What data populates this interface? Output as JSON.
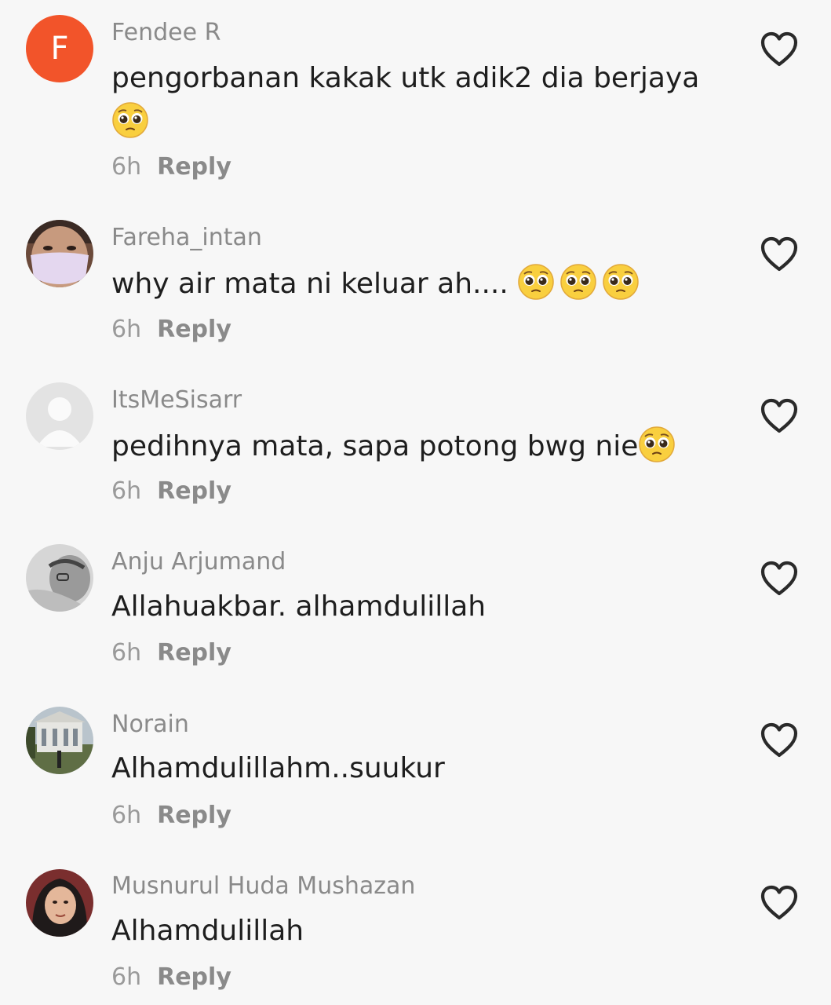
{
  "colors": {
    "background": "#f7f7f7",
    "username": "#8a8a8a",
    "text": "#1e1e1e",
    "meta": "#9a9a9a",
    "avatar_accent": "#f2542a"
  },
  "icons": {
    "like": "heart-outline-icon",
    "emoji": "pleading-face-emoji"
  },
  "comments": [
    {
      "username": "Fendee R",
      "avatar_letter": "F",
      "text": "pengorbanan kakak utk adik2 dia berjaya",
      "time": "6h",
      "reply": "Reply",
      "emoji_count": 1
    },
    {
      "username": "Fareha_intan",
      "text": "why air mata ni keluar ah.... ",
      "time": "6h",
      "reply": "Reply",
      "emoji_count": 3
    },
    {
      "username": "ItsMeSisarr",
      "text": "pedihnya mata, sapa potong bwg nie",
      "time": "6h",
      "reply": "Reply",
      "emoji_count": 1
    },
    {
      "username": "Anju Arjumand",
      "text": "Allahuakbar. alhamdulillah",
      "time": "6h",
      "reply": "Reply",
      "emoji_count": 0
    },
    {
      "username": "Norain",
      "text": "Alhamdulillahm..suukur",
      "time": "6h",
      "reply": "Reply",
      "emoji_count": 0
    },
    {
      "username": "Musnurul Huda Mushazan",
      "text": "Alhamdulillah",
      "time": "6h",
      "reply": "Reply",
      "emoji_count": 0
    }
  ]
}
